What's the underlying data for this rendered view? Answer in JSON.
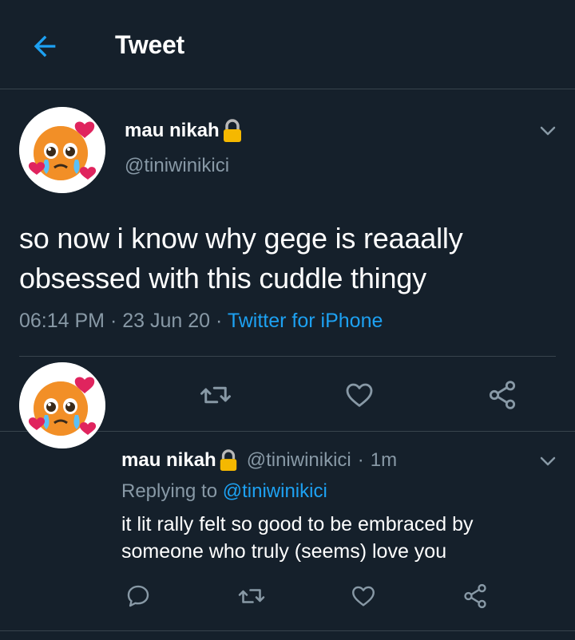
{
  "header": {
    "title": "Tweet",
    "back_icon": "arrow-left-icon"
  },
  "colors": {
    "background": "#15202b",
    "accent": "#1da1f2",
    "secondary_text": "#8899a6",
    "divider": "#38444d"
  },
  "main_tweet": {
    "display_name": "mau nikah",
    "handle": "@tiniwinikici",
    "text": "so now i know why gege is reaaally obsessed with this cuddle thingy",
    "time": "06:14 PM",
    "date": "23 Jun 20",
    "source": "Twitter for iPhone",
    "sep": "·",
    "actions": [
      "reply-icon",
      "retweet-icon",
      "like-icon",
      "share-icon"
    ]
  },
  "reply": {
    "display_name": "mau nikah",
    "handle": "@tiniwinikici",
    "sep": "·",
    "age": "1m",
    "replying_label": "Replying to",
    "replying_to": "@tiniwinikici",
    "text": "it lit rally felt so good to be embraced by someone who truly (seems) love you",
    "actions": [
      "reply-icon",
      "retweet-icon",
      "like-icon",
      "share-icon"
    ]
  }
}
